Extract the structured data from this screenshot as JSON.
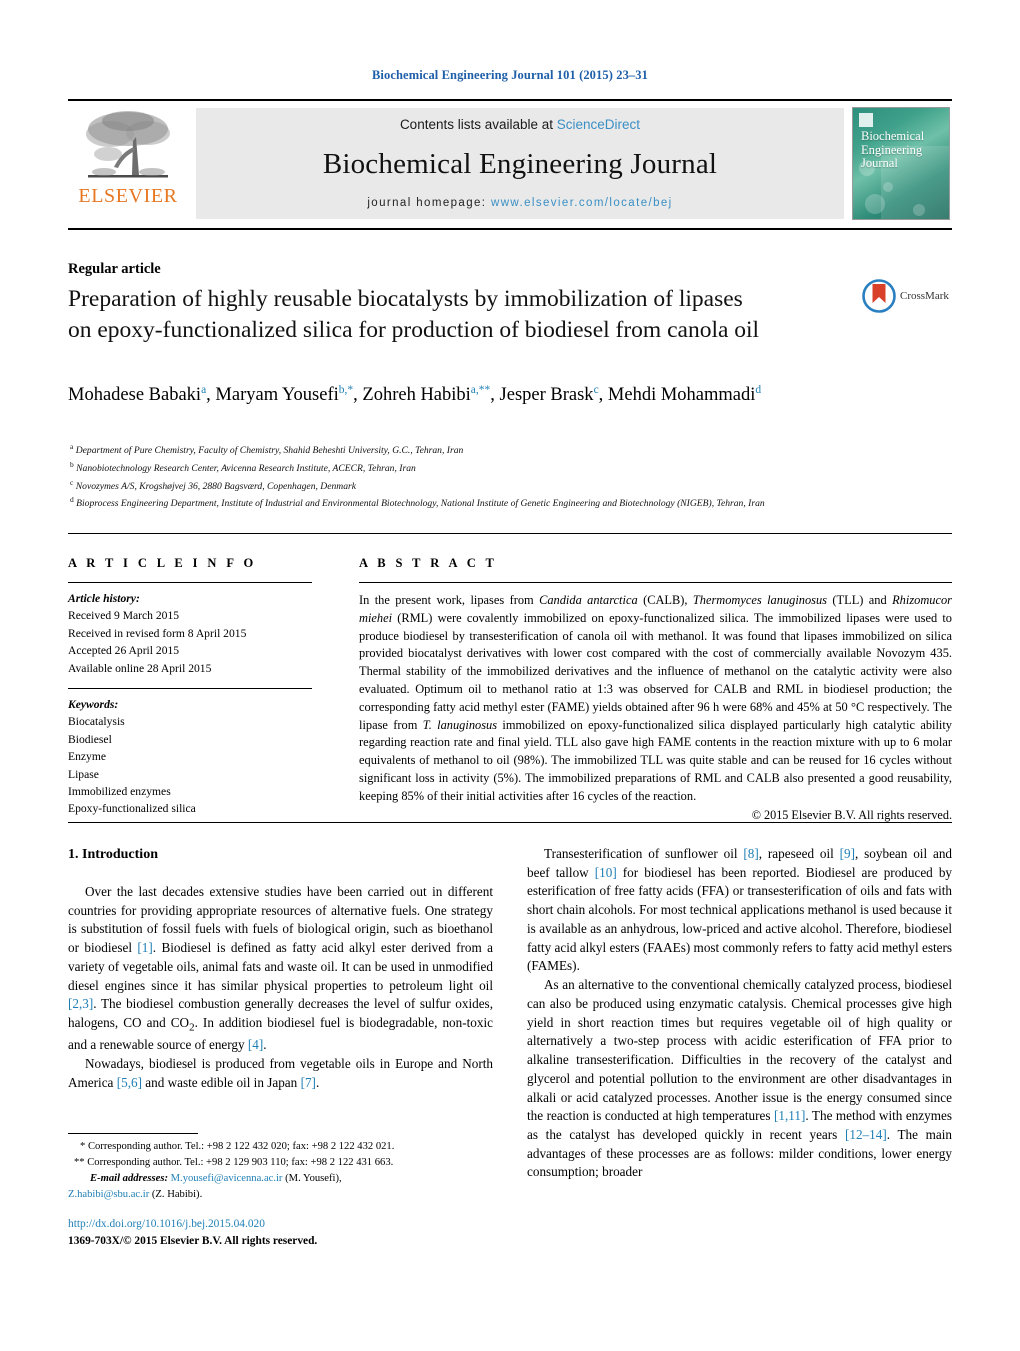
{
  "running_head": "Biochemical Engineering Journal 101 (2015) 23–31",
  "masthead": {
    "publisher_name": "ELSEVIER",
    "contents_prefix": "Contents lists available at ",
    "contents_link": "ScienceDirect",
    "journal_title": "Biochemical Engineering Journal",
    "homepage_prefix": "journal homepage: ",
    "homepage_url": "www.elsevier.com/locate/bej",
    "cover_title_lines": [
      "Biochemical",
      "Engineering",
      "Journal"
    ]
  },
  "article": {
    "type_label": "Regular article",
    "title": "Preparation of highly reusable biocatalysts by immobilization of lipases on epoxy-functionalized silica for production of biodiesel from canola oil",
    "crossmark_label": "CrossMark",
    "authors_html": "Mohadese Babaki<sup>a</sup>, Maryam Yousefi<sup>b,*</sup>, Zohreh Habibi<sup>a,**</sup>, Jesper Brask<sup>c</sup>, Mehdi Mohammadi<sup>d</sup>",
    "affiliations": [
      {
        "marker": "a",
        "text": "Department of Pure Chemistry, Faculty of Chemistry, Shahid Beheshti University, G.C., Tehran, Iran"
      },
      {
        "marker": "b",
        "text": "Nanobiotechnology Research Center, Avicenna Research Institute, ACECR, Tehran, Iran"
      },
      {
        "marker": "c",
        "text": "Novozymes A/S, Krogshøjvej 36, 2880 Bagsværd, Copenhagen, Denmark"
      },
      {
        "marker": "d",
        "text": "Bioprocess Engineering Department, Institute of Industrial and Environmental Biotechnology, National Institute of Genetic Engineering and Biotechnology (NIGEB), Tehran, Iran"
      }
    ]
  },
  "article_info": {
    "heading": "A R T I C L E   I N F O",
    "history_label": "Article history:",
    "history": [
      "Received 9 March 2015",
      "Received in revised form 8 April 2015",
      "Accepted 26 April 2015",
      "Available online 28 April 2015"
    ],
    "keywords_label": "Keywords:",
    "keywords": [
      "Biocatalysis",
      "Biodiesel",
      "Enzyme",
      "Lipase",
      "Immobilized enzymes",
      "Epoxy-functionalized silica"
    ]
  },
  "abstract": {
    "heading": "A B S T R A C T",
    "html": "In the present work, lipases from <i>Candida antarctica</i> (CALB), <i>Thermomyces lanuginosus</i> (TLL) and <i>Rhizomucor miehei</i> (RML) were covalently immobilized on epoxy-functionalized silica. The immobilized lipases were used to produce biodiesel by transesterification of canola oil with methanol. It was found that lipases immobilized on silica provided biocatalyst derivatives with lower cost compared with the cost of commercially available Novozym 435. Thermal stability of the immobilized derivatives and the influence of methanol on the catalytic activity were also evaluated. Optimum oil to methanol ratio at 1:3 was observed for CALB and RML in biodiesel production; the corresponding fatty acid methyl ester (FAME) yields obtained after 96 h were 68% and 45% at 50 °C respectively. The lipase from <i>T. lanuginosus</i> immobilized on epoxy-functionalized silica displayed particularly high catalytic ability regarding reaction rate and final yield. TLL also gave high FAME contents in the reaction mixture with up to 6 molar equivalents of methanol to oil (98%). The immobilized TLL was quite stable and can be reused for 16 cycles without significant loss in activity (5%). The immobilized preparations of RML and CALB also presented a good reusability, keeping 85% of their initial activities after 16 cycles of the reaction.",
    "copyright": "© 2015 Elsevier B.V. All rights reserved."
  },
  "body": {
    "section_heading": "1.  Introduction",
    "left_paragraphs_html": [
      "Over the last decades extensive studies have been carried out in different countries for providing appropriate resources of alternative fuels. One strategy is substitution of fossil fuels with fuels of biological origin, such as bioethanol or biodiesel <span class=\"ref\">[1]</span>. Biodiesel is defined as fatty acid alkyl ester derived from a variety of vegetable oils, animal fats and waste oil. It can be used in unmodified diesel engines since it has similar physical properties to petroleum light oil <span class=\"ref\">[2,3]</span>. The biodiesel combustion generally decreases the level of sulfur oxides, halogens, CO and CO<sub>2</sub>. In addition biodiesel fuel is biodegradable, non-toxic and a renewable source of energy <span class=\"ref\">[4]</span>.",
      "Nowadays, biodiesel is produced from vegetable oils in Europe and North America <span class=\"ref\">[5,6]</span> and waste edible oil in Japan <span class=\"ref\">[7]</span>."
    ],
    "right_paragraphs_html": [
      "Transesterification of sunflower oil <span class=\"ref\">[8]</span>, rapeseed oil <span class=\"ref\">[9]</span>, soybean oil and beef tallow <span class=\"ref\">[10]</span> for biodiesel has been reported. Biodiesel are produced by esterification of free fatty acids (FFA) or transesterification of oils and fats with short chain alcohols. For most technical applications methanol is used because it is available as an anhydrous, low-priced and active alcohol. Therefore, biodiesel fatty acid alkyl esters (FAAEs) most commonly refers to fatty acid methyl esters (FAMEs).",
      "As an alternative to the conventional chemically catalyzed process, biodiesel can also be produced using enzymatic catalysis. Chemical processes give high yield in short reaction times but requires vegetable oil of high quality or alternatively a two-step process with acidic esterification of FFA prior to alkaline transesterification. Difficulties in the recovery of the catalyst and glycerol and potential pollution to the environment are other disadvantages in alkali or acid catalyzed processes. Another issue is the energy consumed since the reaction is conducted at high temperatures <span class=\"ref\">[1,11]</span>. The method with enzymes as the catalyst has developed quickly in recent years <span class=\"ref\">[12–14]</span>. The main advantages of these processes are as follows: milder conditions, lower energy consumption; broader"
    ]
  },
  "footnotes": {
    "corresponding_1": "* Corresponding author. Tel.: +98 2 122 432 020; fax: +98 2 122 432 021.",
    "corresponding_2": "** Corresponding author. Tel.: +98 2 129 903 110; fax: +98 2 122 431 663.",
    "email_label": "E-mail addresses:",
    "email_1": "M.yousefi@avicenna.ac.ir",
    "email_1_owner": "(M. Yousefi),",
    "email_2": "Z.habibi@sbu.ac.ir",
    "email_2_owner": "(Z. Habibi)."
  },
  "footer": {
    "doi": "http://dx.doi.org/10.1016/j.bej.2015.04.020",
    "issn_line": "1369-703X/© 2015 Elsevier B.V. All rights reserved."
  }
}
